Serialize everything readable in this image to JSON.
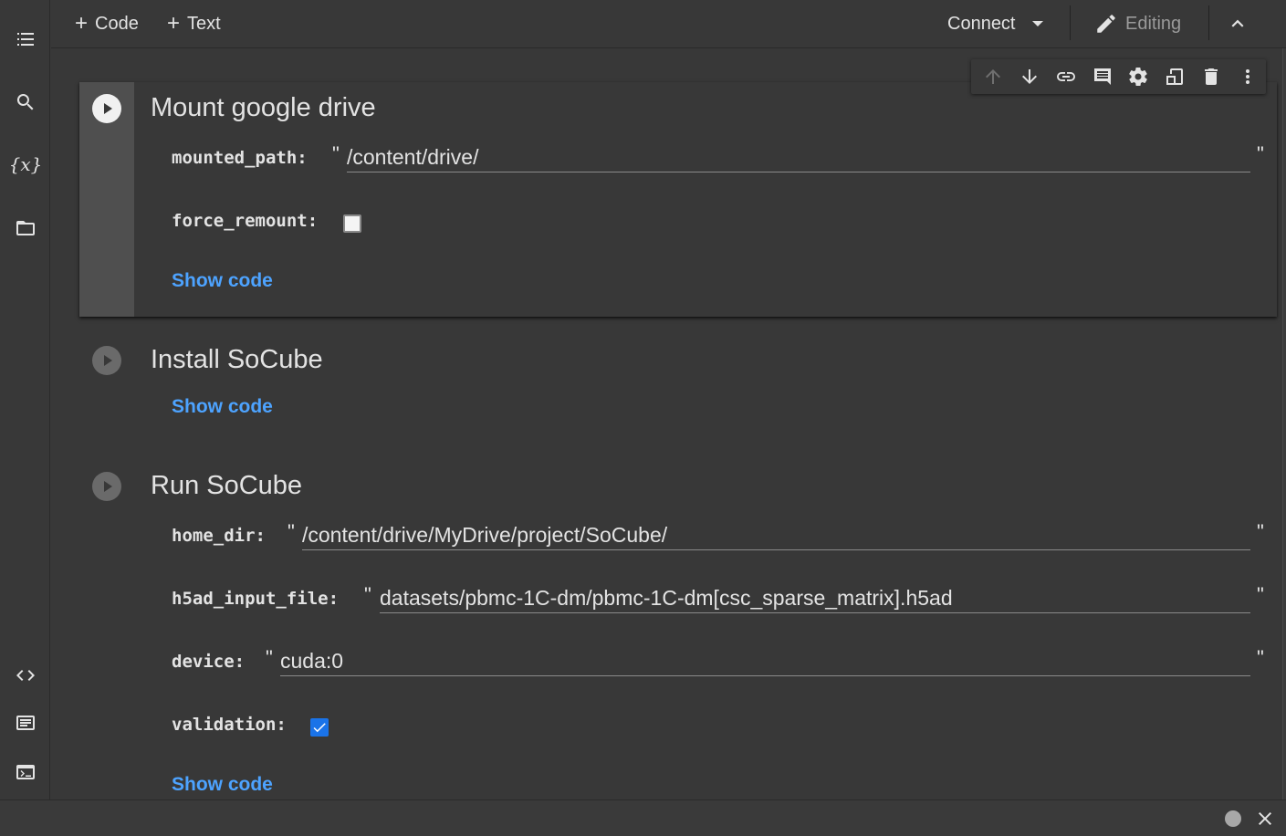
{
  "toolbar": {
    "add_code_label": "Code",
    "add_text_label": "Text",
    "connect_label": "Connect",
    "editing_label": "Editing"
  },
  "sidebar": {
    "items": [
      {
        "name": "table-of-contents",
        "icon": "list-icon"
      },
      {
        "name": "find",
        "icon": "search-icon"
      },
      {
        "name": "variables",
        "icon": "variables-icon",
        "glyph": "{x}"
      },
      {
        "name": "files",
        "icon": "folder-icon"
      },
      {
        "name": "code-snippets",
        "icon": "code-icon"
      },
      {
        "name": "command-palette",
        "icon": "keyboard-icon"
      },
      {
        "name": "terminal",
        "icon": "terminal-icon"
      }
    ]
  },
  "cells": [
    {
      "title": "Mount google drive",
      "params": [
        {
          "label": "mounted_path:",
          "type": "text",
          "value": "/content/drive/"
        },
        {
          "label": "force_remount:",
          "type": "checkbox",
          "checked": false
        }
      ],
      "show_code": "Show code"
    },
    {
      "title": "Install SoCube",
      "params": [],
      "show_code": "Show code"
    },
    {
      "title": "Run SoCube",
      "params": [
        {
          "label": "home_dir:",
          "type": "text",
          "value": "/content/drive/MyDrive/project/SoCube/"
        },
        {
          "label": "h5ad_input_file:",
          "type": "text",
          "value": "datasets/pbmc-1C-dm/pbmc-1C-dm[csc_sparse_matrix].h5ad"
        },
        {
          "label": "device:",
          "type": "text",
          "value": "cuda:0"
        },
        {
          "label": "validation:",
          "type": "checkbox",
          "checked": true
        }
      ],
      "show_code": "Show code"
    }
  ],
  "quote_char": "\"",
  "colors": {
    "background": "#383838",
    "gutter_active": "#4f4f4f",
    "link": "#4da3ff",
    "checkbox_checked": "#1a73e8"
  }
}
